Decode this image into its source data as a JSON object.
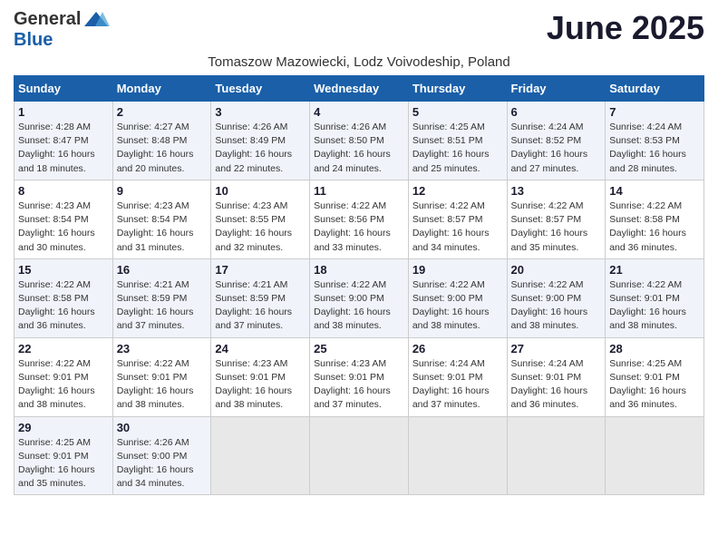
{
  "logo": {
    "general": "General",
    "blue": "Blue"
  },
  "title": "June 2025",
  "subtitle": "Tomaszow Mazowiecki, Lodz Voivodeship, Poland",
  "days_of_week": [
    "Sunday",
    "Monday",
    "Tuesday",
    "Wednesday",
    "Thursday",
    "Friday",
    "Saturday"
  ],
  "weeks": [
    [
      {
        "day": "1",
        "detail": "Sunrise: 4:28 AM\nSunset: 8:47 PM\nDaylight: 16 hours\nand 18 minutes."
      },
      {
        "day": "2",
        "detail": "Sunrise: 4:27 AM\nSunset: 8:48 PM\nDaylight: 16 hours\nand 20 minutes."
      },
      {
        "day": "3",
        "detail": "Sunrise: 4:26 AM\nSunset: 8:49 PM\nDaylight: 16 hours\nand 22 minutes."
      },
      {
        "day": "4",
        "detail": "Sunrise: 4:26 AM\nSunset: 8:50 PM\nDaylight: 16 hours\nand 24 minutes."
      },
      {
        "day": "5",
        "detail": "Sunrise: 4:25 AM\nSunset: 8:51 PM\nDaylight: 16 hours\nand 25 minutes."
      },
      {
        "day": "6",
        "detail": "Sunrise: 4:24 AM\nSunset: 8:52 PM\nDaylight: 16 hours\nand 27 minutes."
      },
      {
        "day": "7",
        "detail": "Sunrise: 4:24 AM\nSunset: 8:53 PM\nDaylight: 16 hours\nand 28 minutes."
      }
    ],
    [
      {
        "day": "8",
        "detail": "Sunrise: 4:23 AM\nSunset: 8:54 PM\nDaylight: 16 hours\nand 30 minutes."
      },
      {
        "day": "9",
        "detail": "Sunrise: 4:23 AM\nSunset: 8:54 PM\nDaylight: 16 hours\nand 31 minutes."
      },
      {
        "day": "10",
        "detail": "Sunrise: 4:23 AM\nSunset: 8:55 PM\nDaylight: 16 hours\nand 32 minutes."
      },
      {
        "day": "11",
        "detail": "Sunrise: 4:22 AM\nSunset: 8:56 PM\nDaylight: 16 hours\nand 33 minutes."
      },
      {
        "day": "12",
        "detail": "Sunrise: 4:22 AM\nSunset: 8:57 PM\nDaylight: 16 hours\nand 34 minutes."
      },
      {
        "day": "13",
        "detail": "Sunrise: 4:22 AM\nSunset: 8:57 PM\nDaylight: 16 hours\nand 35 minutes."
      },
      {
        "day": "14",
        "detail": "Sunrise: 4:22 AM\nSunset: 8:58 PM\nDaylight: 16 hours\nand 36 minutes."
      }
    ],
    [
      {
        "day": "15",
        "detail": "Sunrise: 4:22 AM\nSunset: 8:58 PM\nDaylight: 16 hours\nand 36 minutes."
      },
      {
        "day": "16",
        "detail": "Sunrise: 4:21 AM\nSunset: 8:59 PM\nDaylight: 16 hours\nand 37 minutes."
      },
      {
        "day": "17",
        "detail": "Sunrise: 4:21 AM\nSunset: 8:59 PM\nDaylight: 16 hours\nand 37 minutes."
      },
      {
        "day": "18",
        "detail": "Sunrise: 4:22 AM\nSunset: 9:00 PM\nDaylight: 16 hours\nand 38 minutes."
      },
      {
        "day": "19",
        "detail": "Sunrise: 4:22 AM\nSunset: 9:00 PM\nDaylight: 16 hours\nand 38 minutes."
      },
      {
        "day": "20",
        "detail": "Sunrise: 4:22 AM\nSunset: 9:00 PM\nDaylight: 16 hours\nand 38 minutes."
      },
      {
        "day": "21",
        "detail": "Sunrise: 4:22 AM\nSunset: 9:01 PM\nDaylight: 16 hours\nand 38 minutes."
      }
    ],
    [
      {
        "day": "22",
        "detail": "Sunrise: 4:22 AM\nSunset: 9:01 PM\nDaylight: 16 hours\nand 38 minutes."
      },
      {
        "day": "23",
        "detail": "Sunrise: 4:22 AM\nSunset: 9:01 PM\nDaylight: 16 hours\nand 38 minutes."
      },
      {
        "day": "24",
        "detail": "Sunrise: 4:23 AM\nSunset: 9:01 PM\nDaylight: 16 hours\nand 38 minutes."
      },
      {
        "day": "25",
        "detail": "Sunrise: 4:23 AM\nSunset: 9:01 PM\nDaylight: 16 hours\nand 37 minutes."
      },
      {
        "day": "26",
        "detail": "Sunrise: 4:24 AM\nSunset: 9:01 PM\nDaylight: 16 hours\nand 37 minutes."
      },
      {
        "day": "27",
        "detail": "Sunrise: 4:24 AM\nSunset: 9:01 PM\nDaylight: 16 hours\nand 36 minutes."
      },
      {
        "day": "28",
        "detail": "Sunrise: 4:25 AM\nSunset: 9:01 PM\nDaylight: 16 hours\nand 36 minutes."
      }
    ],
    [
      {
        "day": "29",
        "detail": "Sunrise: 4:25 AM\nSunset: 9:01 PM\nDaylight: 16 hours\nand 35 minutes."
      },
      {
        "day": "30",
        "detail": "Sunrise: 4:26 AM\nSunset: 9:00 PM\nDaylight: 16 hours\nand 34 minutes."
      },
      {
        "day": "",
        "detail": ""
      },
      {
        "day": "",
        "detail": ""
      },
      {
        "day": "",
        "detail": ""
      },
      {
        "day": "",
        "detail": ""
      },
      {
        "day": "",
        "detail": ""
      }
    ]
  ]
}
